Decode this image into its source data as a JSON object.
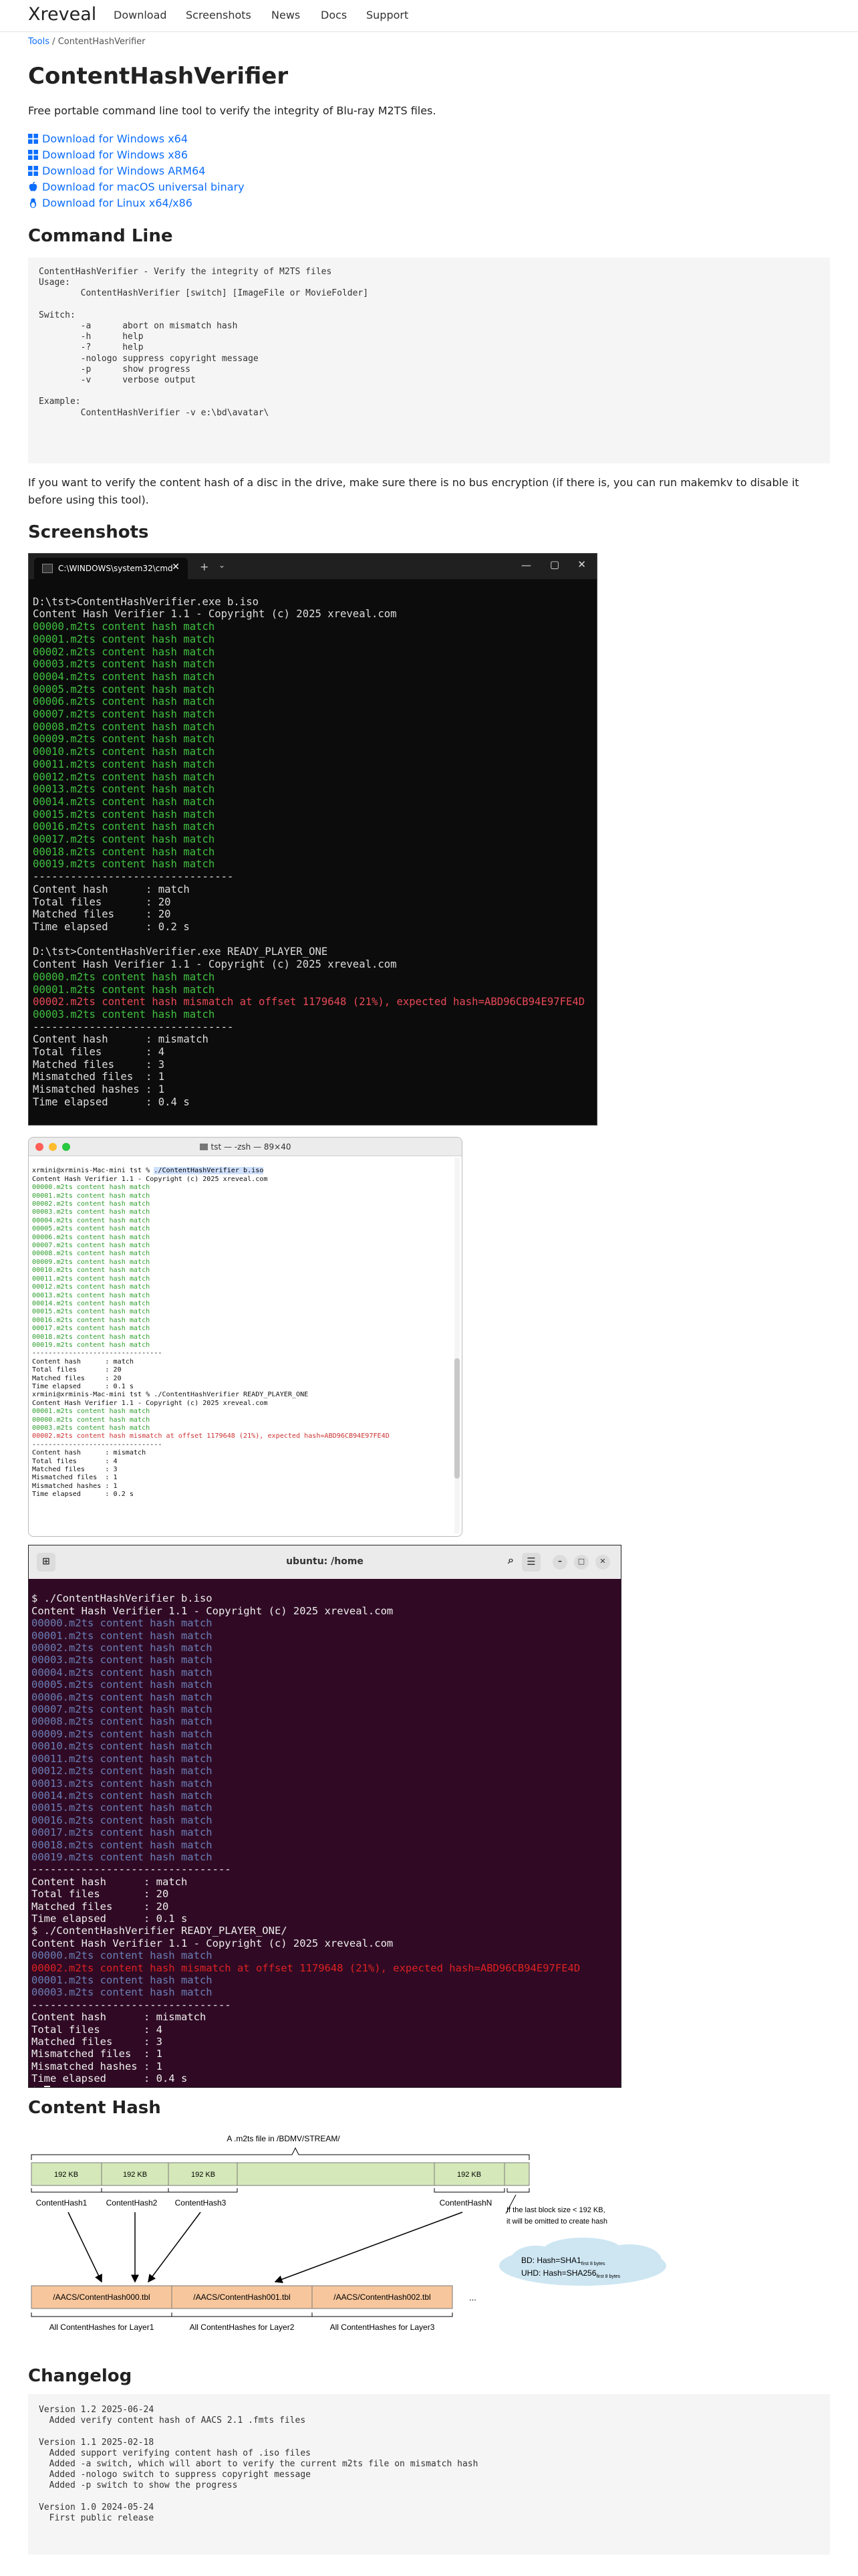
{
  "nav": {
    "brand": "Xreveal",
    "links": [
      "Download",
      "Screenshots",
      "News",
      "Docs",
      "Support"
    ]
  },
  "breadcrumb": {
    "root": "Tools",
    "sep": " / ",
    "current": "ContentHashVerifier"
  },
  "title": "ContentHashVerifier",
  "lead": "Free portable command line tool to verify the integrity of Blu-ray M2TS files.",
  "downloads": [
    {
      "label": "Download for Windows x64",
      "icon": "windows-icon"
    },
    {
      "label": "Download for Windows x86",
      "icon": "windows-icon"
    },
    {
      "label": "Download for Windows ARM64",
      "icon": "windows-icon"
    },
    {
      "label": "Download for macOS universal binary",
      "icon": "apple-icon"
    },
    {
      "label": "Download for Linux x64/x86",
      "icon": "linux-icon"
    }
  ],
  "sections": {
    "command_line": "Command Line",
    "screenshots": "Screenshots",
    "content_hash": "Content Hash",
    "changelog": "Changelog"
  },
  "usage": "ContentHashVerifier - Verify the integrity of M2TS files\nUsage:\n        ContentHashVerifier [switch] [ImageFile or MovieFolder]\n\nSwitch:\n        -a      abort on mismatch hash\n        -h      help\n        -?      help\n        -nologo suppress copyright message\n        -p      show progress\n        -v      verbose output\n\nExample:\n        ContentHashVerifier -v e:\\bd\\avatar\\",
  "note": "If you want to verify the content hash of a disc in the drive, make sure there is no bus encryption (if there is, you can run makemkv to disable it before using this tool).",
  "windows_terminal": {
    "tab_title": "C:\\WINDOWS\\system32\\cmd",
    "cmd1": "D:\\tst>ContentHashVerifier.exe b.iso",
    "banner": "Content Hash Verifier 1.1 - Copyright (c) 2025 xreveal.com",
    "ok_lines": [
      "00000.m2ts content hash match",
      "00001.m2ts content hash match",
      "00002.m2ts content hash match",
      "00003.m2ts content hash match",
      "00004.m2ts content hash match",
      "00005.m2ts content hash match",
      "00006.m2ts content hash match",
      "00007.m2ts content hash match",
      "00008.m2ts content hash match",
      "00009.m2ts content hash match",
      "00010.m2ts content hash match",
      "00011.m2ts content hash match",
      "00012.m2ts content hash match",
      "00013.m2ts content hash match",
      "00014.m2ts content hash match",
      "00015.m2ts content hash match",
      "00016.m2ts content hash match",
      "00017.m2ts content hash match",
      "00018.m2ts content hash match",
      "00019.m2ts content hash match"
    ],
    "divider": "--------------------------------",
    "summary1": [
      "Content hash      : match",
      "Total files       : 20",
      "Matched files     : 20",
      "Time elapsed      : 0.2 s"
    ],
    "cmd2": "D:\\tst>ContentHashVerifier.exe READY_PLAYER_ONE",
    "ok2": [
      "00000.m2ts content hash match",
      "00001.m2ts content hash match"
    ],
    "bad2": "00002.m2ts content hash mismatch at offset 1179648 (21%), expected hash=ABD96CB94E97FE4D",
    "ok3": "00003.m2ts content hash match",
    "summary2": [
      "Content hash      : mismatch",
      "Total files       : 4",
      "Matched files     : 3",
      "Mismatched files  : 1",
      "Mismatched hashes : 1",
      "Time elapsed      : 0.4 s"
    ]
  },
  "mac_terminal": {
    "title": "tst — -zsh — 89×40",
    "prompt1": "xrmini@xrminis-Mac-mini tst % ",
    "cmd1": "./ContentHashVerifier b.iso",
    "banner": "Content Hash Verifier 1.1 - Copyright (c) 2025 xreveal.com",
    "summary1": [
      "Content hash      : match",
      "Total files       : 20",
      "Matched files     : 20",
      "Time elapsed      : 0.1 s"
    ],
    "prompt2": "xrmini@xrminis-Mac-mini tst % ./ContentHashVerifier READY_PLAYER_ONE",
    "ok2": [
      "00001.m2ts content hash match",
      "00000.m2ts content hash match",
      "00003.m2ts content hash match"
    ],
    "bad2": "00002.m2ts content hash mismatch at offset 1179648 (21%), expected hash=ABD96CB94E97FE4D",
    "summary2": [
      "Content hash      : mismatch",
      "Total files       : 4",
      "Matched files     : 3",
      "Mismatched files  : 1",
      "Mismatched hashes : 1",
      "Time elapsed      : 0.2 s"
    ]
  },
  "ubuntu_terminal": {
    "title": "ubuntu: /home",
    "cmd1": "$ ./ContentHashVerifier b.iso",
    "banner": "Content Hash Verifier 1.1 - Copyright (c) 2025 xreveal.com",
    "summary1": [
      "Content hash      : match",
      "Total files       : 20",
      "Matched files     : 20",
      "Time elapsed      : 0.1 s"
    ],
    "cmd2": "$ ./ContentHashVerifier READY_PLAYER_ONE/",
    "ok_first": "00000.m2ts content hash match",
    "bad2": "00002.m2ts content hash mismatch at offset 1179648 (21%), expected hash=ABD96CB94E97FE4D",
    "ok2": [
      "00001.m2ts content hash match",
      "00003.m2ts content hash match"
    ],
    "summary2": [
      "Content hash      : mismatch",
      "Total files       : 4",
      "Matched files     : 3",
      "Mismatched files  : 1",
      "Mismatched hashes : 1",
      "Time elapsed      : 0.4 s"
    ],
    "prompt": "$ "
  },
  "diagram": {
    "caption": "A .m2ts file in /BDMV/STREAM/",
    "block": "192 KB",
    "hashes": [
      "ContentHash1",
      "ContentHash2",
      "ContentHash3",
      "ContentHashN"
    ],
    "note_line1": "If the last block size < 192 KB,",
    "note_line2": "it will be omitted to create hash",
    "tables": [
      "/AACS/ContentHash000.tbl",
      "/AACS/ContentHash001.tbl",
      "/AACS/ContentHash002.tbl"
    ],
    "ellipsis": "...",
    "layers": [
      "All ContentHashes for Layer1",
      "All ContentHashes for Layer2",
      "All ContentHashes for Layer3"
    ],
    "cloud_bd": "BD:   Hash=SHA1",
    "cloud_bd_sub": "first 8 bytes",
    "cloud_uhd": "UHD: Hash=SHA256",
    "cloud_uhd_sub": "first 8 bytes",
    "colors": {
      "bar": "#d5e8b9",
      "table": "#f7c69c",
      "cloud": "#cde6f2"
    }
  },
  "changelog": "Version 1.2 2025-06-24\n  Added verify content hash of AACS 2.1 .fmts files\n\nVersion 1.1 2025-02-18\n  Added support verifying content hash of .iso files\n  Added -a switch, which will abort to verify the current m2ts file on mismatch hash\n  Added -nologo switch to suppress copyright message\n  Added -p switch to show the progress\n\nVersion 1.0 2024-05-24\n  First public release"
}
